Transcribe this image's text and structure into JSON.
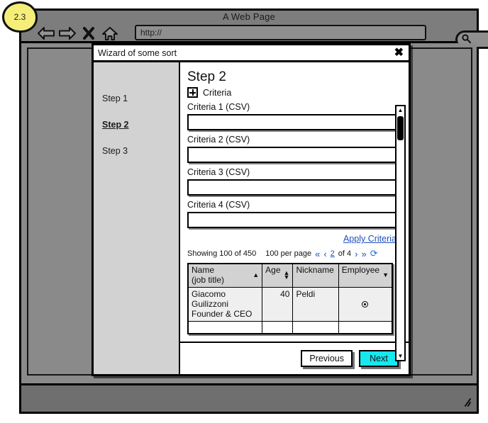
{
  "annotation": {
    "label": "2.3"
  },
  "browser": {
    "title": "A Web Page",
    "toolbar": {
      "back_icon": "back-arrow-icon",
      "forward_icon": "forward-arrow-icon",
      "stop_icon": "close-x-icon",
      "home_icon": "home-icon",
      "search_icon": "search-icon"
    },
    "url_value": "http://",
    "url_placeholder": "http://",
    "search_value": "",
    "statusbar": {
      "resize_grip_icon": "resize-grip-icon"
    }
  },
  "dialog": {
    "title": "Wizard of some sort",
    "close_icon": "close-x-icon",
    "sidebar": {
      "items": [
        {
          "label": "Step 1",
          "active": false
        },
        {
          "label": "Step 2",
          "active": true
        },
        {
          "label": "Step 3",
          "active": false
        }
      ]
    },
    "main": {
      "heading": "Step 2",
      "criteria_toggle": {
        "icon": "plus-box-icon",
        "label": "Criteria"
      },
      "fields": [
        {
          "label": "Criteria 1 (CSV)",
          "value": "",
          "placeholder": ""
        },
        {
          "label": "Criteria 2 (CSV)",
          "value": "",
          "placeholder": ""
        },
        {
          "label": "Criteria 3 (CSV)",
          "value": "",
          "placeholder": ""
        },
        {
          "label": "Criteria 4 (CSV)",
          "value": "",
          "placeholder": ""
        }
      ],
      "apply_link": "Apply Criteria",
      "pagination": {
        "showing": "Showing 100 of 450",
        "per_page": "100 per page",
        "first_icon": "«",
        "prev_icon": "‹",
        "current_page": "2",
        "of_label": "of 4",
        "next_icon": "›",
        "last_icon": "»",
        "refresh_icon": "⟳"
      },
      "table": {
        "columns": [
          {
            "label": "Name\n(job title)",
            "line1": "Name",
            "line2": "(job title)",
            "sort": "asc"
          },
          {
            "label": "Age",
            "line1": "Age",
            "line2": "",
            "sort": "both"
          },
          {
            "label": "Nickname",
            "line1": "Nickname",
            "line2": "",
            "sort": "none"
          },
          {
            "label": "Employee",
            "line1": "Employee",
            "line2": "",
            "sort": "desc"
          }
        ],
        "rows": [
          {
            "name": "Giacomo Guilizzoni",
            "job_title": "Founder & CEO",
            "age": "40",
            "nickname": "Peldi",
            "employee": "selected"
          }
        ]
      },
      "scrollbar": {
        "up_icon": "▲",
        "down_icon": "▼",
        "thumb": "scroll-thumb"
      }
    },
    "footer": {
      "previous_label": "Previous",
      "next_label": "Next"
    }
  },
  "colors": {
    "accent_cyan": "#17e7ef",
    "link_blue": "#1f4fbf",
    "sticky_yellow": "#f5ef7a",
    "chrome_gray": "#8a8a8a",
    "sidebar_gray": "#d2d2d2"
  }
}
